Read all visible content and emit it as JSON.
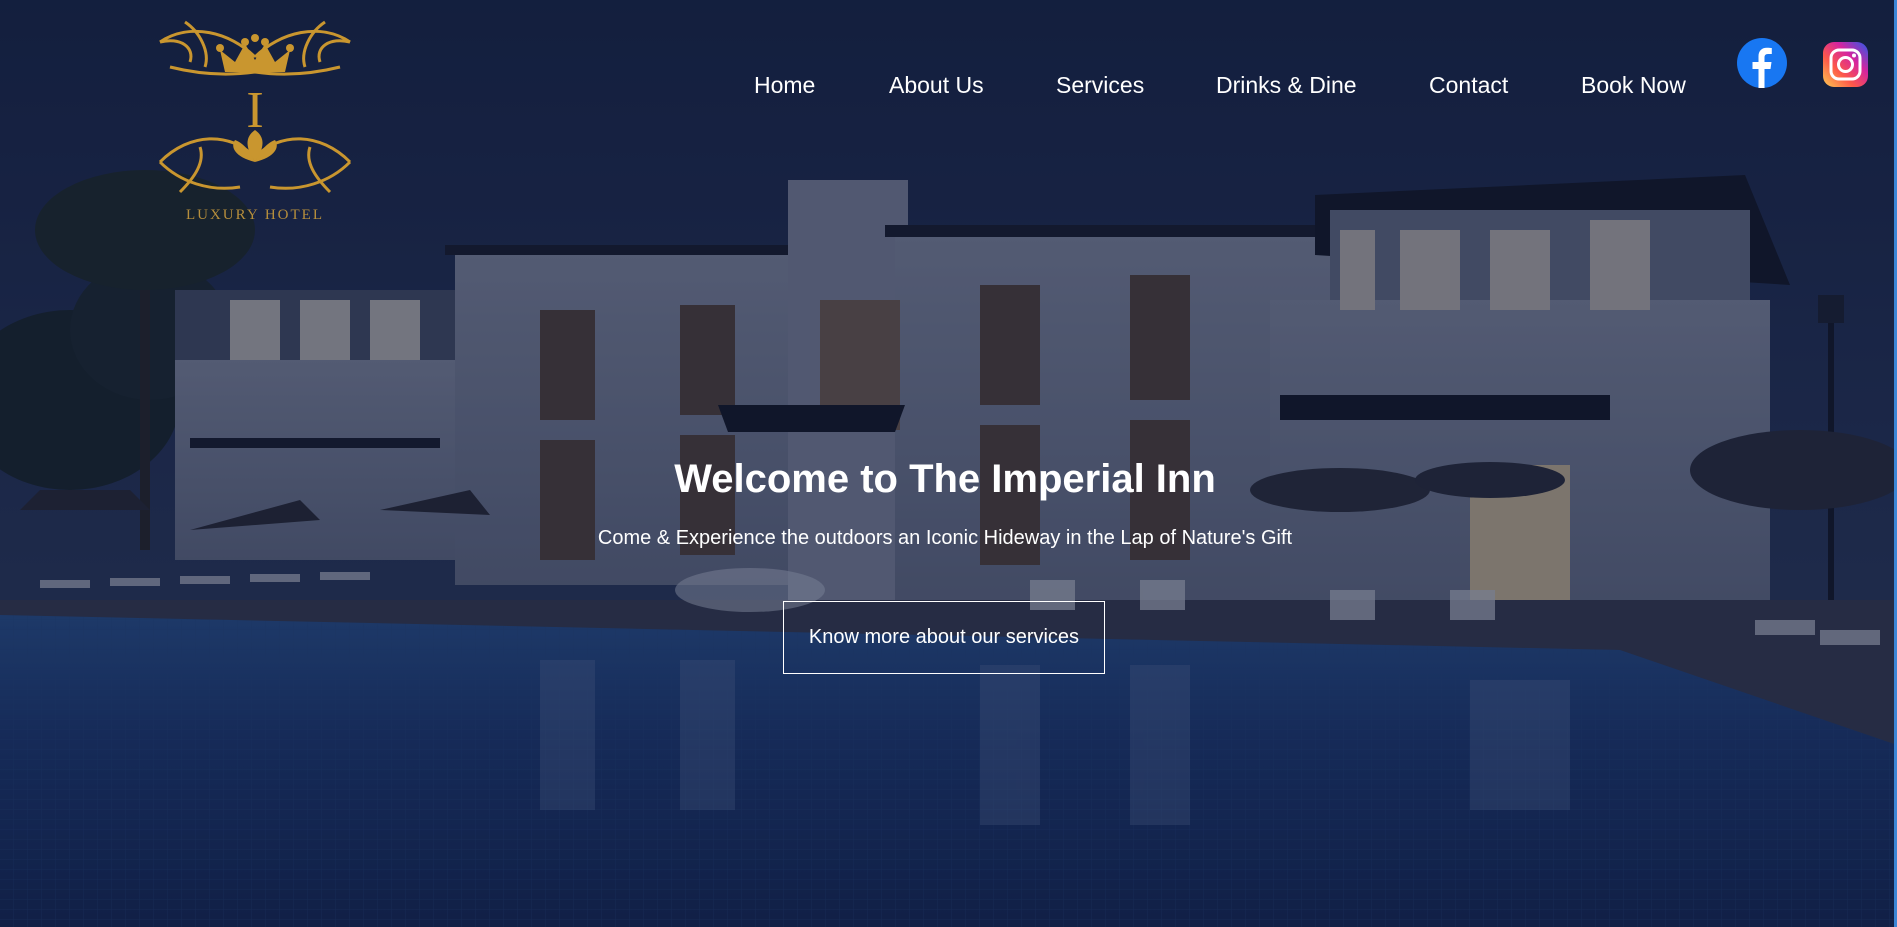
{
  "logo": {
    "initial": "I",
    "tagline": "LUXURY HOTEL",
    "color": "#c9962f"
  },
  "nav": {
    "items": [
      {
        "label": "Home"
      },
      {
        "label": "About Us"
      },
      {
        "label": "Services"
      },
      {
        "label": "Drinks & Dine"
      },
      {
        "label": "Contact"
      },
      {
        "label": "Book Now"
      }
    ]
  },
  "social": {
    "facebook": {
      "icon": "facebook-icon",
      "color": "#1877f2"
    },
    "instagram": {
      "icon": "instagram-icon"
    }
  },
  "hero": {
    "title": "Welcome to The Imperial Inn",
    "subtitle": "Come & Experience the outdoors an Iconic Hideway in the Lap of Nature's Gift",
    "cta_label": "Know more about our services"
  }
}
